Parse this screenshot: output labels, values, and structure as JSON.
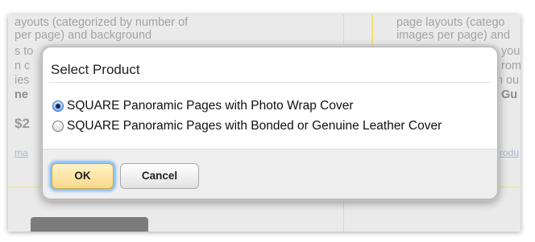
{
  "background": {
    "left_text": [
      "ayouts (categorized by number of",
      " per page) and background"
    ],
    "left_fragments": [
      "s to",
      "n c",
      "ies",
      "ne",
      "$2",
      "ma"
    ],
    "right_text": [
      "page layouts (catego",
      "images per page) and"
    ],
    "right_fragments": [
      "you",
      "rom",
      "h ou",
      "Gu",
      "rodu"
    ]
  },
  "dialog": {
    "title": "Select Product",
    "options": [
      {
        "label": "SQUARE Panoramic Pages with Photo Wrap Cover",
        "checked": true
      },
      {
        "label": "SQUARE Panoramic Pages with Bonded or Genuine Leather Cover",
        "checked": false
      }
    ],
    "buttons": {
      "ok": "OK",
      "cancel": "Cancel"
    }
  },
  "colors": {
    "ok_button": "#f8d98a",
    "focus_ring": "#8ec5ff",
    "radio_selected": "#3a72c8",
    "background_panel": "#eaeaea"
  }
}
